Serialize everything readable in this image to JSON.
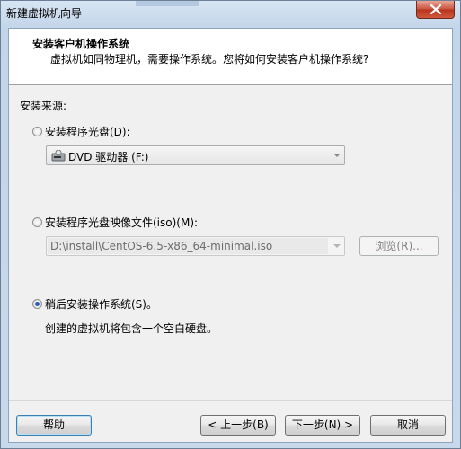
{
  "window": {
    "title": "新建虚拟机向导"
  },
  "header": {
    "title": "安装客户机操作系统",
    "subtitle": "虚拟机如同物理机，需要操作系统。您将如何安装客户机操作系统?"
  },
  "install_source_label": "安装来源:",
  "options": {
    "disc": {
      "label": "安装程序光盘(D):",
      "selected": false,
      "drive_value": "DVD 驱动器 (F:)"
    },
    "iso": {
      "label": "安装程序光盘映像文件(iso)(M):",
      "selected": false,
      "path_value": "D:\\install\\CentOS-6.5-x86_64-minimal.iso",
      "browse_label": "浏览(R)..."
    },
    "later": {
      "label": "稍后安装操作系统(S)。",
      "selected": true,
      "note": "创建的虚拟机将包含一个空白硬盘。"
    }
  },
  "buttons": {
    "help": "帮助",
    "back": "< 上一步(B)",
    "next": "下一步(N) >",
    "cancel": "取消"
  }
}
